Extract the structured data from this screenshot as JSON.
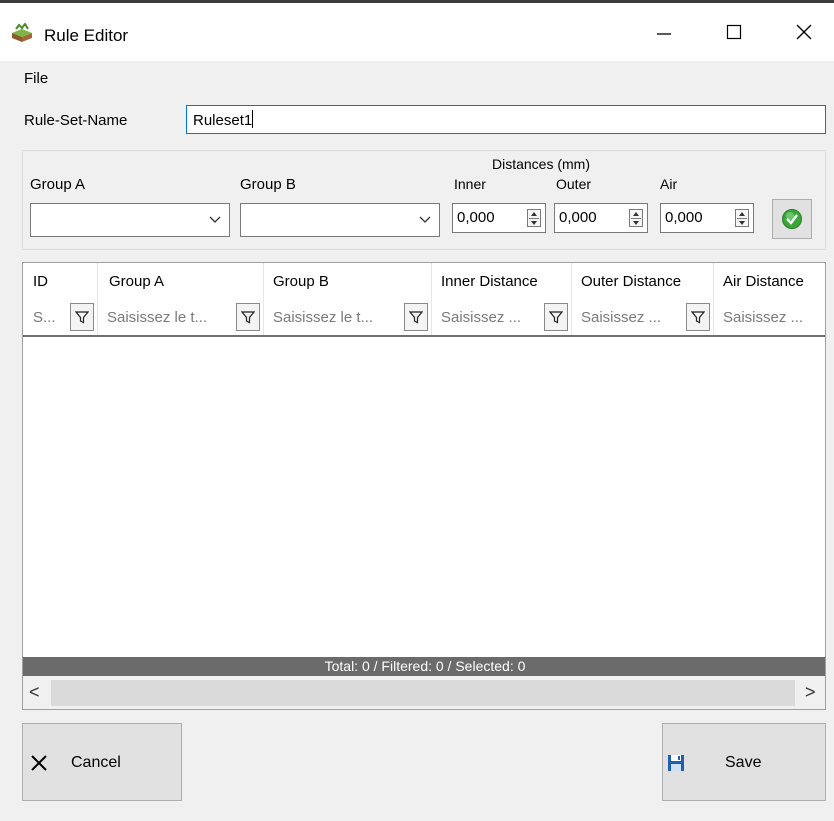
{
  "window": {
    "title": "Rule Editor",
    "minimize_glyph": "—",
    "maximize_glyph": "☐",
    "close_glyph": "✕"
  },
  "menu": {
    "file": "File"
  },
  "ruleset": {
    "label": "Rule-Set-Name",
    "value": "Ruleset1"
  },
  "editor": {
    "group_a_label": "Group A",
    "group_b_label": "Group B",
    "group_a_value": "",
    "group_b_value": "",
    "distances_label": "Distances (mm)",
    "inner_label": "Inner",
    "outer_label": "Outer",
    "air_label": "Air",
    "inner_value": "0,000",
    "outer_value": "0,000",
    "air_value": "0,000"
  },
  "grid": {
    "columns": [
      {
        "header": "ID",
        "filter_placeholder": "S..."
      },
      {
        "header": "Group A",
        "filter_placeholder": "Saisissez le t..."
      },
      {
        "header": "Group B",
        "filter_placeholder": "Saisissez le t..."
      },
      {
        "header": "Inner Distance",
        "filter_placeholder": "Saisissez ..."
      },
      {
        "header": "Outer Distance",
        "filter_placeholder": "Saisissez ..."
      },
      {
        "header": "Air Distance",
        "filter_placeholder": "Saisissez ..."
      }
    ],
    "rows": [],
    "status": "Total: 0 / Filtered: 0 / Selected: 0",
    "scroll_left": "<",
    "scroll_right": ">"
  },
  "buttons": {
    "cancel": "Cancel",
    "save": "Save"
  },
  "colors": {
    "accent": "#0078d7",
    "status_bar": "#6b6b6b",
    "apply_green": "#3aa63a",
    "save_blue": "#1f5fae"
  },
  "icons": [
    "app-icon",
    "filter-icon",
    "checkmark-icon",
    "close-x-icon",
    "save-disk-icon"
  ]
}
